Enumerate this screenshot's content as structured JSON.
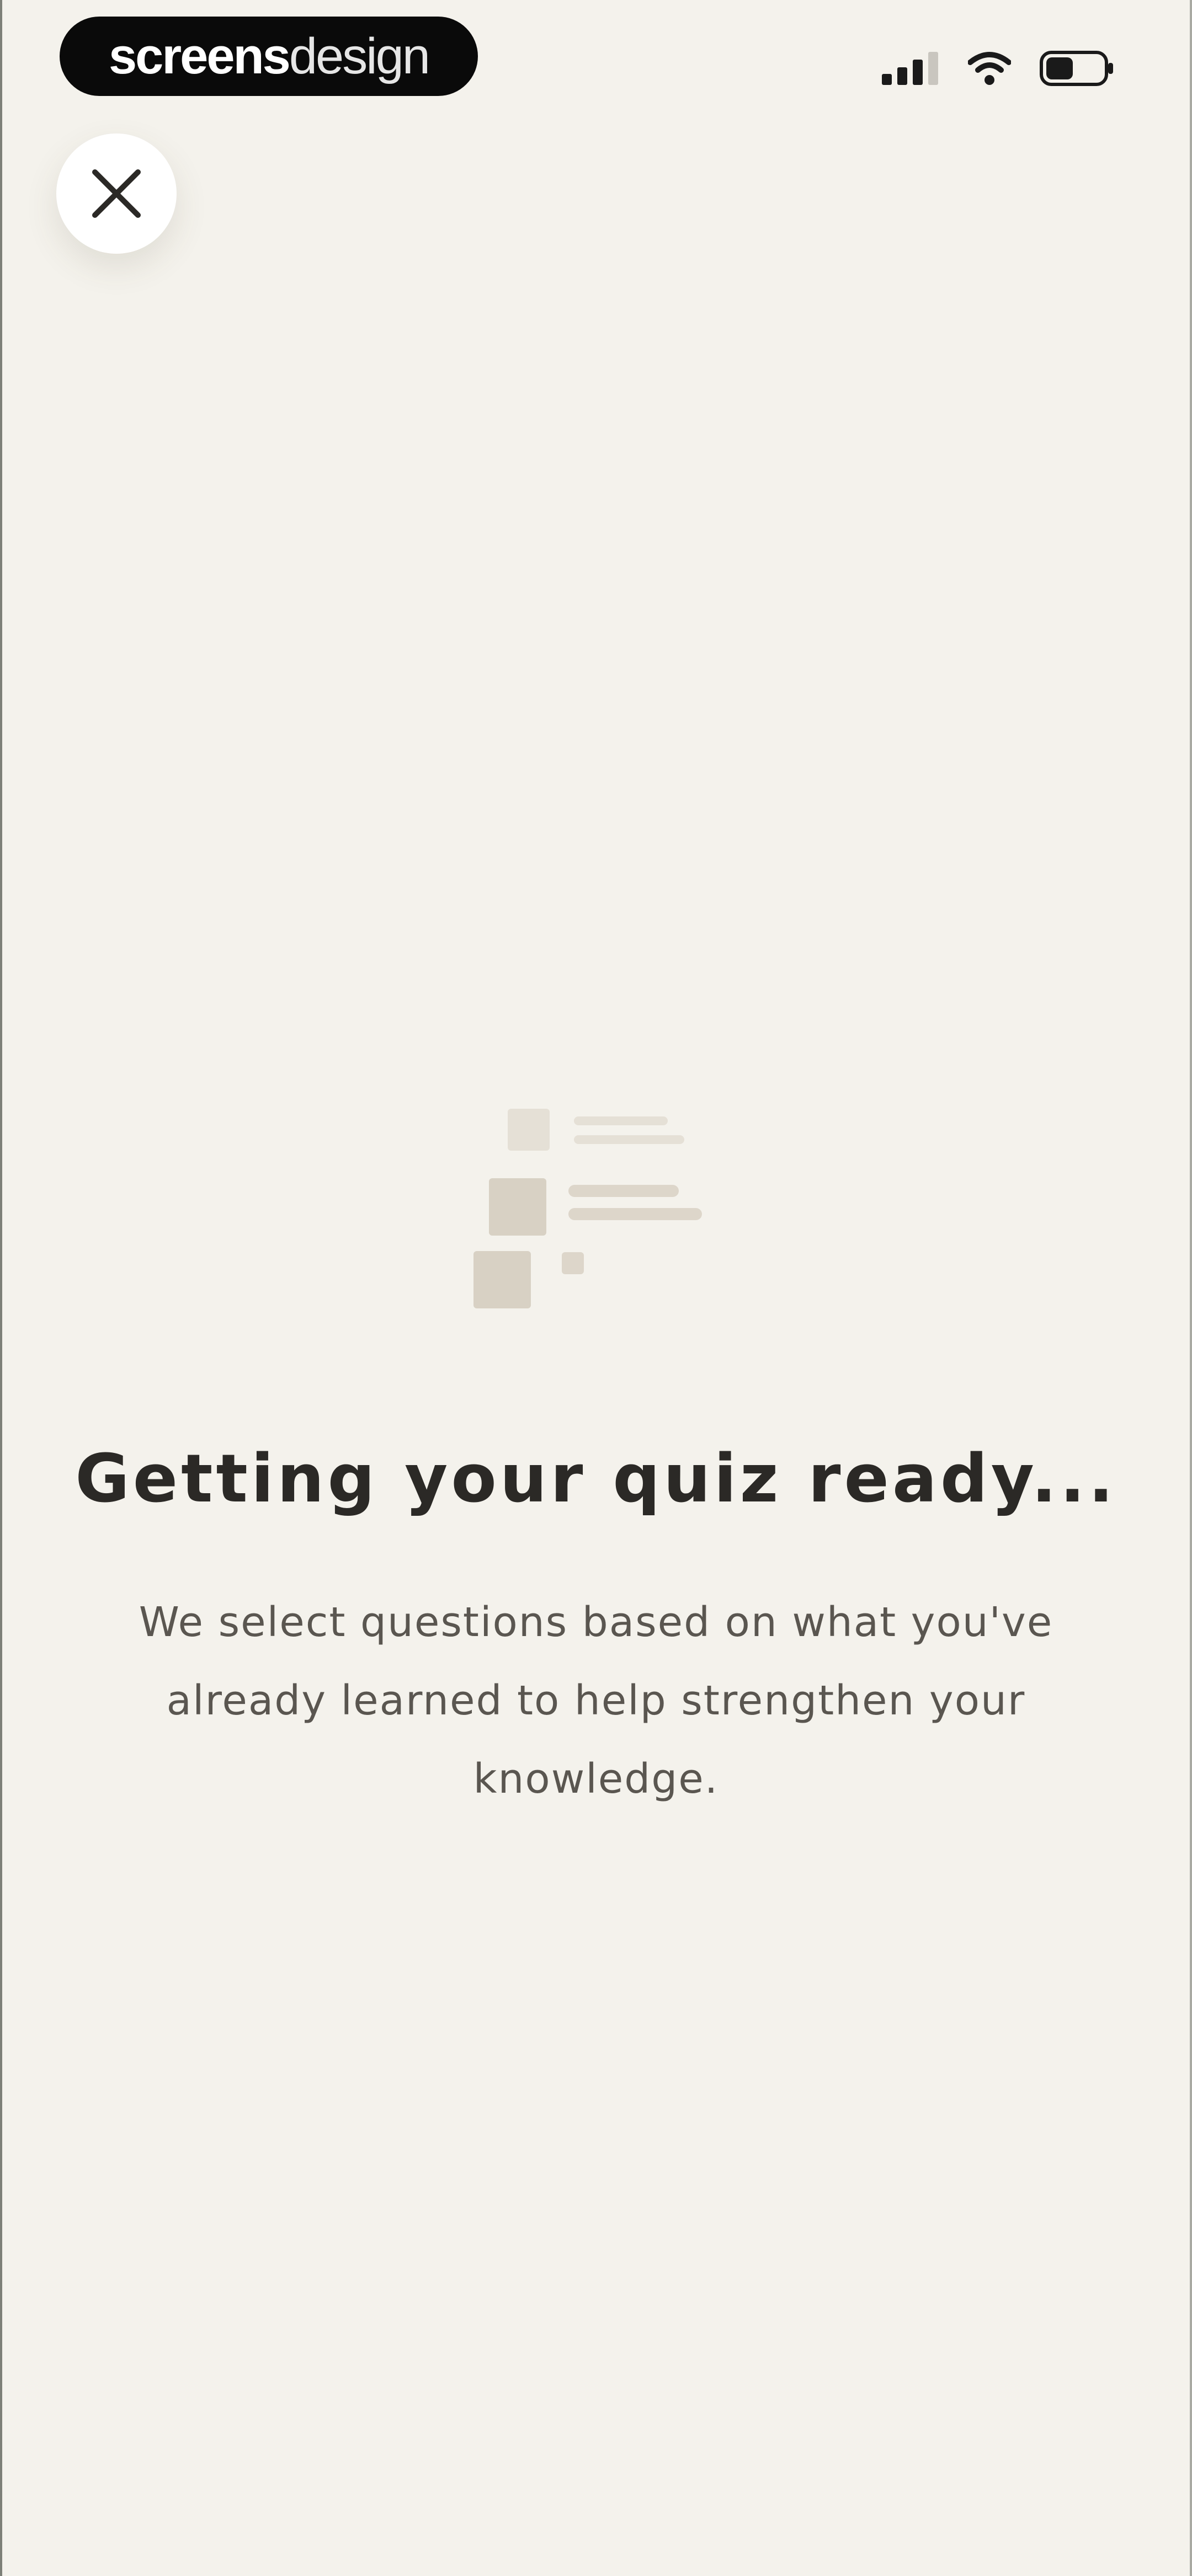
{
  "status_bar": {
    "brand_bold": "screens",
    "brand_light": "design",
    "icons": [
      "signal-icon",
      "wifi-icon",
      "battery-icon"
    ]
  },
  "close_button": {
    "icon": "close-icon"
  },
  "illustration": {
    "icon": "quiz-list-icon",
    "colors": {
      "square": "#d8d1c4",
      "line": "#ddd6ca"
    }
  },
  "content": {
    "title": "Getting your quiz ready...",
    "description": "We select questions based on what you've already learned to help strengthen your knowledge."
  },
  "colors": {
    "background": "#f4f2ec",
    "title": "#2b2926",
    "body": "#5a5650"
  }
}
